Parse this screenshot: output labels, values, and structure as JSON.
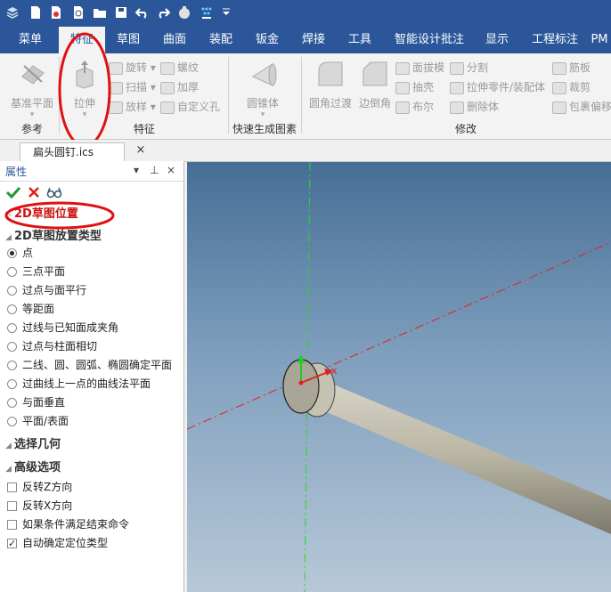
{
  "qat": {
    "icons": [
      "app-menu-icon",
      "new-file-icon",
      "new-drawing-icon",
      "preview-icon",
      "open-folder-icon",
      "save-icon",
      "undo-icon",
      "redo-icon",
      "settings-icon",
      "display-icon",
      "dropdown-icon"
    ]
  },
  "tabs": [
    "菜单",
    "特征",
    "草图",
    "曲面",
    "装配",
    "钣金",
    "焊接",
    "工具",
    "智能设计批注",
    "显示",
    "工程标注",
    "PM"
  ],
  "ribbon": {
    "ref_big": "基准平面",
    "extrude_big": "拉伸",
    "revolve": "旋转",
    "sweep": "扫描",
    "loft": "放样",
    "thread": "螺纹",
    "thicken": "加厚",
    "custom_hole": "自定义孔",
    "cone_big": "圆锥体",
    "fillet_big": "圆角过渡",
    "chamfer_big": "边倒角",
    "draft": "面拔模",
    "shell": "抽壳",
    "boolean": "布尔",
    "split": "分割",
    "extrude_part": "拉伸零件/装配体",
    "delete_body": "删除体",
    "rib": "筋板",
    "trim": "裁剪",
    "wrap_offset": "包裹偏移",
    "group_ref": "参考",
    "group_feature": "特征",
    "group_quick": "快速生成图素",
    "group_modify": "修改"
  },
  "doc_tab": {
    "title": "扁头圆钉.ics",
    "close": "×"
  },
  "panel": {
    "title": "属性",
    "pin": "▾",
    "pin2": "ᵖ",
    "close": "×",
    "section_2d_pos": "2D草图位置",
    "section_placement": "2D草图放置类型",
    "options": [
      "点",
      "三点平面",
      "过点与面平行",
      "等距面",
      "过线与已知面成夹角",
      "过点与柱面相切",
      "二线、圆、圆弧、椭圆确定平面",
      "过曲线上一点的曲线法平面",
      "与面垂直",
      "平面/表面"
    ],
    "selected_option": 0,
    "section_select": "选择几何",
    "section_advanced": "高级选项",
    "checks": [
      {
        "label": "反转Z方向",
        "checked": false
      },
      {
        "label": "反转X方向",
        "checked": false
      },
      {
        "label": "如果条件满足结束命令",
        "checked": false
      },
      {
        "label": "自动确定定位类型",
        "checked": true
      }
    ]
  },
  "viewport": {
    "axis_label_x": "x"
  }
}
